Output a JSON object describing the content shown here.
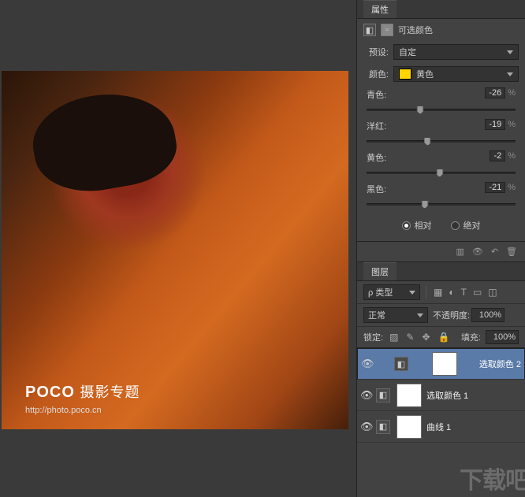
{
  "watermark": {
    "brand": "POCO",
    "title": "摄影专题",
    "url": "http://photo.poco.cn"
  },
  "properties": {
    "tab": "属性",
    "title": "可选颜色",
    "preset_label": "预设:",
    "preset_value": "自定",
    "color_label": "颜色:",
    "color_value": "黄色",
    "color_swatch": "#ffd400",
    "sliders": [
      {
        "label": "青色:",
        "value": "-26",
        "pct": 36
      },
      {
        "label": "洋红:",
        "value": "-19",
        "pct": 41
      },
      {
        "label": "黄色:",
        "value": "-2",
        "pct": 49
      },
      {
        "label": "黑色:",
        "value": "-21",
        "pct": 39
      }
    ],
    "radio_rel": "相对",
    "radio_abs": "绝对"
  },
  "layers": {
    "tab": "图层",
    "kind": "类型",
    "blend": "正常",
    "opacity_label": "不透明度:",
    "opacity": "100%",
    "lock_label": "锁定:",
    "fill_label": "填充:",
    "fill": "100%",
    "items": [
      {
        "name": "选取颜色 2",
        "selected": true
      },
      {
        "name": "选取颜色 1",
        "selected": false
      },
      {
        "name": "曲线 1",
        "selected": false
      }
    ]
  },
  "corner_wm": "下载吧"
}
